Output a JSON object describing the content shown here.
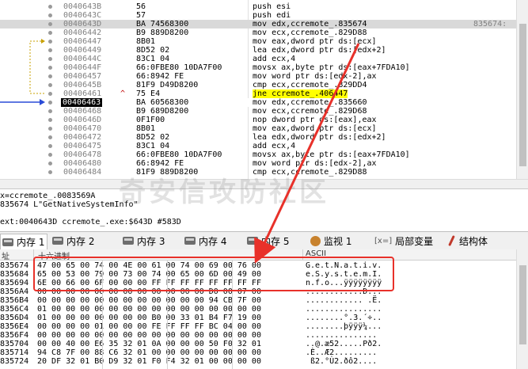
{
  "disasm": {
    "rows": [
      {
        "addr": "0040643B",
        "mark": "",
        "bytes": "56",
        "instr": "push esi",
        "comment": "",
        "cls": ""
      },
      {
        "addr": "0040643C",
        "mark": "",
        "bytes": "57",
        "instr": "push edi",
        "comment": "",
        "cls": ""
      },
      {
        "addr": "0040643D",
        "mark": "",
        "bytes": "BA 74568300",
        "instr": "mov edx,ccremote_.835674",
        "comment": "835674:",
        "cls": "hl-cur"
      },
      {
        "addr": "00406442",
        "mark": "",
        "bytes": "B9 889D8200",
        "instr": "mov ecx,ccremote_.829D88",
        "comment": "",
        "cls": ""
      },
      {
        "addr": "00406447",
        "mark": "",
        "bytes": "8B01",
        "instr": "mov eax,dword ptr ds:[ecx]",
        "comment": "",
        "cls": ""
      },
      {
        "addr": "00406449",
        "mark": "",
        "bytes": "8D52 02",
        "instr": "lea edx,dword ptr ds:[edx+2]",
        "comment": "",
        "cls": ""
      },
      {
        "addr": "0040644C",
        "mark": "",
        "bytes": "83C1 04",
        "instr": "add ecx,4",
        "comment": "",
        "cls": ""
      },
      {
        "addr": "0040644F",
        "mark": "",
        "bytes": "66:0FBE80 10DA7F00",
        "instr": "movsx ax,byte ptr ds:[eax+7FDA10]",
        "comment": "",
        "cls": ""
      },
      {
        "addr": "00406457",
        "mark": "",
        "bytes": "66:8942 FE",
        "instr": "mov word ptr ds:[edx-2],ax",
        "comment": "",
        "cls": ""
      },
      {
        "addr": "0040645B",
        "mark": "",
        "bytes": "81F9 D49D8200",
        "instr": "cmp ecx,ccremote_.829DD4",
        "comment": "",
        "cls": ""
      },
      {
        "addr": "00406461",
        "mark": "^",
        "bytes": "75 E4",
        "instr": "jne ccremote_.406447",
        "comment": "",
        "cls": ""
      },
      {
        "addr": "00406463",
        "mark": "",
        "bytes": "BA 60568300",
        "instr": "mov edx,ccremote_.835660",
        "comment": "",
        "cls": "hl-eip"
      },
      {
        "addr": "00406468",
        "mark": "",
        "bytes": "B9 689D8200",
        "instr": "mov ecx,ccremote_.829D68",
        "comment": "",
        "cls": ""
      },
      {
        "addr": "0040646D",
        "mark": "",
        "bytes": "0F1F00",
        "instr": "nop dword ptr ds:[eax],eax",
        "comment": "",
        "cls": ""
      },
      {
        "addr": "00406470",
        "mark": "",
        "bytes": "8B01",
        "instr": "mov eax,dword ptr ds:[ecx]",
        "comment": "",
        "cls": ""
      },
      {
        "addr": "00406472",
        "mark": "",
        "bytes": "8D52 02",
        "instr": "lea edx,dword ptr ds:[edx+2]",
        "comment": "",
        "cls": ""
      },
      {
        "addr": "00406475",
        "mark": "",
        "bytes": "83C1 04",
        "instr": "add ecx,4",
        "comment": "",
        "cls": ""
      },
      {
        "addr": "00406478",
        "mark": "",
        "bytes": "66:0FBE80 10DA7F00",
        "instr": "movsx ax,byte ptr ds:[eax+7FDA10]",
        "comment": "",
        "cls": ""
      },
      {
        "addr": "00406480",
        "mark": "",
        "bytes": "66:8942 FE",
        "instr": "mov word ptr ds:[edx-2],ax",
        "comment": "",
        "cls": ""
      },
      {
        "addr": "00406484",
        "mark": "",
        "bytes": "81F9 889D8200",
        "instr": "cmp ecx,ccremote_.829D88",
        "comment": "",
        "cls": ""
      }
    ],
    "top_partial_comment": "8"
  },
  "info": {
    "line1": "x=ccremote_.0083569A",
    "line2": "835674 L\"GetNativeSystemInfo\"",
    "line3": "ext:0040643D ccremote_.exe:$643D #583D"
  },
  "tabs": [
    {
      "label": "内存 1",
      "icon": "memory-icon",
      "active": true
    },
    {
      "label": "内存 2",
      "icon": "memory-icon",
      "active": false
    },
    {
      "label": "内存 3",
      "icon": "memory-icon",
      "active": false
    },
    {
      "label": "内存 4",
      "icon": "memory-icon",
      "active": false
    },
    {
      "label": "内存 5",
      "icon": "memory-icon",
      "active": false
    },
    {
      "label": "监视 1",
      "icon": "watch-icon",
      "active": false
    },
    {
      "label": "局部变量",
      "icon": "locals-icon",
      "active": false
    },
    {
      "label": "结构体",
      "icon": "struct-icon",
      "active": false
    }
  ],
  "locals_icon_text": "[x=]",
  "dump": {
    "header_addr": "址",
    "header_hex": "十六进制",
    "header_ascii": "ASCII",
    "rows": [
      {
        "addr": "835674",
        "hex": "47 00 65 00 74 00 4E 00 61 00 74 00 69 00 76 00",
        "ascii": "G.e.t.N.a.t.i.v."
      },
      {
        "addr": "835684",
        "hex": "65 00 53 00 79 00 73 00 74 00 65 00 6D 00 49 00",
        "ascii": "e.S.y.s.t.e.m.I."
      },
      {
        "addr": "835694",
        "hex": "6E 00 66 00 6F 00 00 00 FF FF FF FF FF FF FF FF",
        "ascii": "n.f.o...ÿÿÿÿÿÿÿÿ"
      },
      {
        "addr": "8356A4",
        "hex": "00 00 00 00 00 00 00 00 00 00 00 00 D0 00 07 00",
        "ascii": "............Ð..."
      },
      {
        "addr": "8356B4",
        "hex": "00 00 00 00 00 00 00 00 00 00 00 00 94 CB 7F 00",
        "ascii": "............ .Ë."
      },
      {
        "addr": "8356C4",
        "hex": "01 00 00 00 00 00 00 00 00 00 00 00 00 00 00 00",
        "ascii": "................"
      },
      {
        "addr": "8356D4",
        "hex": "01 00 00 00 00 00 00 00 B0 00 33 01 B4 F7 19 00",
        "ascii": "........°.3.´÷.."
      },
      {
        "addr": "8356E4",
        "hex": "00 00 00 00 01 00 00 00 FE FF FF FF BC 04 00 00",
        "ascii": "........þÿÿÿ¼..."
      },
      {
        "addr": "8356F4",
        "hex": "00 00 00 00 00 00 00 00 00 00 00 00 00 00 00 00",
        "ascii": "..............."
      },
      {
        "addr": "835704",
        "hex": "00 00 40 00 E6 35 32 01 0A 00 00 00 50 F0 32 01",
        "ascii": "..@.æ52.....Pð2."
      },
      {
        "addr": "835714",
        "hex": "94 C8 7F 00 88 C6 32 01 00 00 00 00 00 00 00 00",
        "ascii": ".È..Æ2........."
      },
      {
        "addr": "835724",
        "hex": "20 DF 32 01 B0 D9 32 01 F0 F4 32 01 00 00 00 00",
        "ascii": " ß2.°Ù2.ðô2...."
      }
    ]
  },
  "watermark": "奇安信攻防社区",
  "colors": {
    "highlight_box": "#e8312a",
    "selected_addr_bg": "#000000",
    "jump_highlight": "#ffff00",
    "branch_arrow": "#2a4bd7",
    "loop_line": "#c8a000"
  }
}
